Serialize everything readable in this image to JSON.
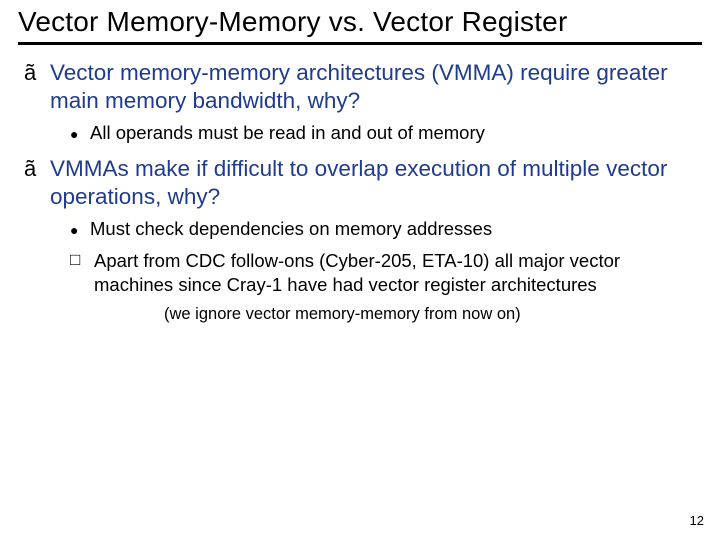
{
  "title": "Vector Memory-Memory vs. Vector Register",
  "bullets": {
    "b1": "Vector memory-memory architectures (VMMA) require greater main memory bandwidth, why?",
    "b1a": "All operands must be read in and out of memory",
    "b2": "VMMAs make if difficult to overlap execution of multiple vector operations, why?",
    "b2a": "Must check dependencies on memory addresses",
    "b3": "Apart from CDC follow-ons (Cyber-205, ETA-10) all major vector machines since Cray-1 have had vector register architectures",
    "note": "(we ignore vector memory-memory from now on)"
  },
  "glyphs": {
    "level1": "ã",
    "round": "●",
    "square_hollow": "□"
  },
  "page_number": "12"
}
